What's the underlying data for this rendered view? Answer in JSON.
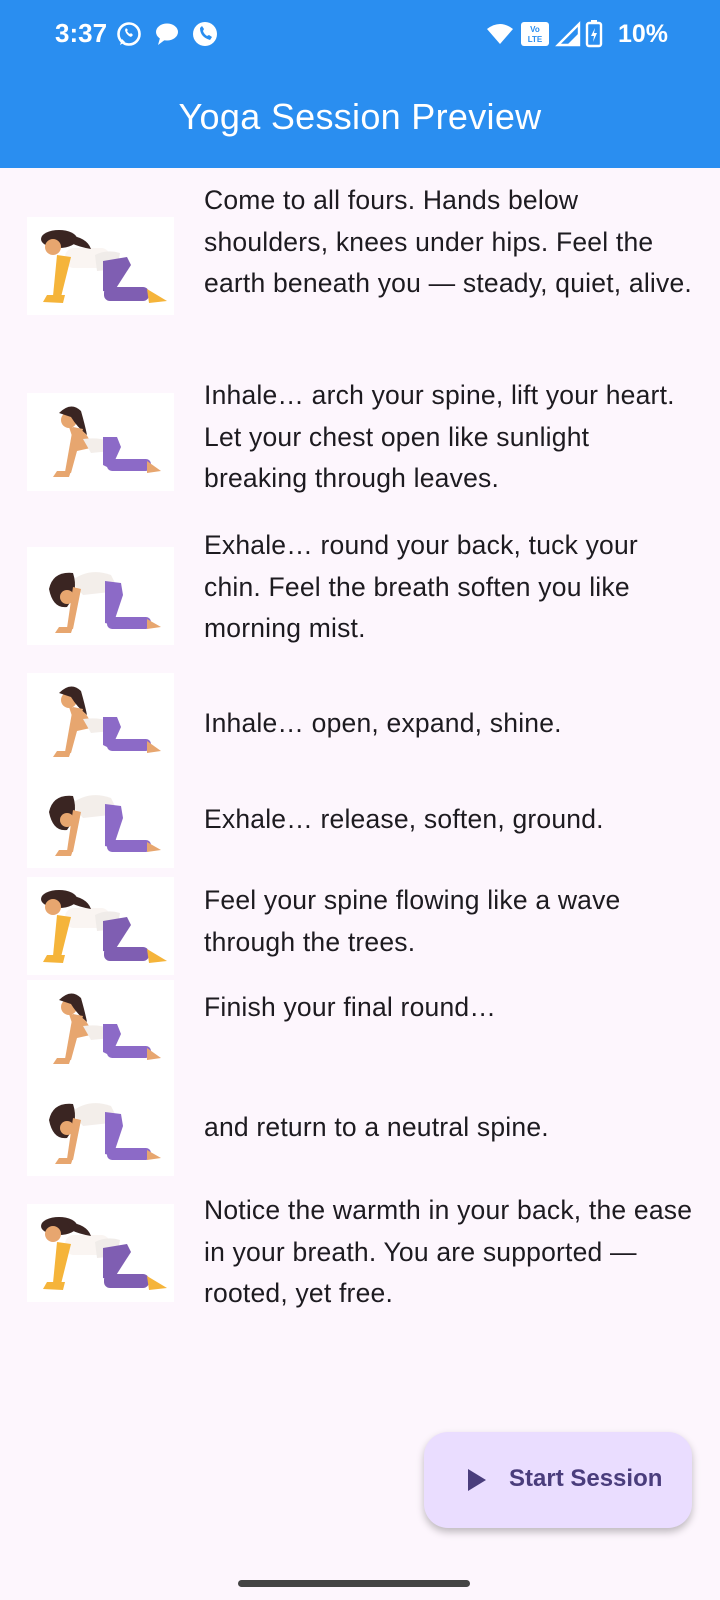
{
  "status_bar": {
    "time": "3:37",
    "battery_percent": "10%",
    "left_icons": [
      "whatsapp-icon",
      "message-bubble-icon",
      "phone-app-icon"
    ],
    "right_icons": [
      "wifi-icon",
      "volte-icon",
      "signal-icon",
      "battery-charging-icon"
    ]
  },
  "app_bar": {
    "title": "Yoga Session Preview",
    "color": "#2a8ef0"
  },
  "steps": [
    {
      "pose": "tabletop-pose-icon",
      "text": "Come to all fours. Hands below shoulders, knees under hips. Feel the earth beneath you — steady, quiet, alive."
    },
    {
      "pose": "cow-pose-icon",
      "text": "Inhale… arch your spine, lift your heart. Let your chest open like sunlight breaking through leaves."
    },
    {
      "pose": "cat-pose-icon",
      "text": "Exhale… round your back, tuck your chin. Feel the breath soften you like morning mist."
    },
    {
      "pose": "cow-pose-icon",
      "text": "Inhale… open, expand, shine."
    },
    {
      "pose": "cat-pose-icon",
      "text": "Exhale… release, soften, ground."
    },
    {
      "pose": "tabletop-pose-icon",
      "text": "Feel your spine flowing like a wave through the trees."
    },
    {
      "pose": "cow-pose-icon",
      "text": "Finish your final round…"
    },
    {
      "pose": "cat-pose-icon",
      "text": "and return to a neutral spine."
    },
    {
      "pose": "tabletop-pose-icon",
      "text": "Notice the warmth in your back, the ease in your breath. You are supported — rooted, yet free."
    }
  ],
  "fab": {
    "label": "Start Session",
    "icon": "play-icon",
    "background": "#eaddff"
  }
}
